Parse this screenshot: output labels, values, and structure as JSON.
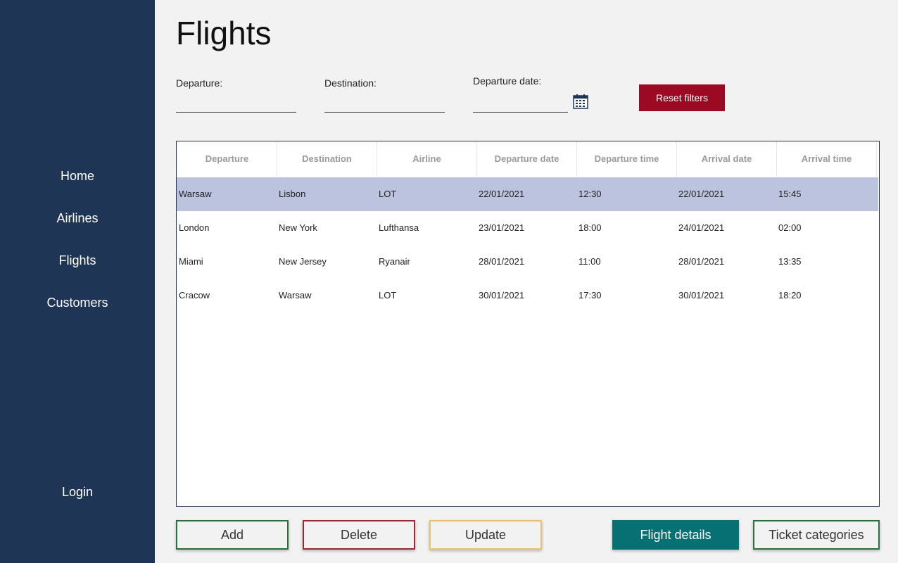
{
  "sidebar": {
    "items": [
      {
        "label": "Home"
      },
      {
        "label": "Airlines"
      },
      {
        "label": "Flights"
      },
      {
        "label": "Customers"
      }
    ],
    "login_label": "Login"
  },
  "page": {
    "title": "Flights"
  },
  "filters": {
    "departure_label": "Departure:",
    "departure_value": "",
    "destination_label": "Destination:",
    "destination_value": "",
    "date_label": "Departure date:",
    "date_value": "",
    "calendar_icon": "calendar-icon",
    "reset_label": "Reset filters"
  },
  "table": {
    "columns": [
      "Departure",
      "Destination",
      "Airline",
      "Departure date",
      "Departure time",
      "Arrival date",
      "Arrival time"
    ],
    "selected_row": 0,
    "rows": [
      [
        "Warsaw",
        "Lisbon",
        "LOT",
        "22/01/2021",
        "12:30",
        "22/01/2021",
        "15:45"
      ],
      [
        "London",
        "New York",
        "Lufthansa",
        "23/01/2021",
        "18:00",
        "24/01/2021",
        "02:00"
      ],
      [
        "Miami",
        "New Jersey",
        "Ryanair",
        "28/01/2021",
        "11:00",
        "28/01/2021",
        "13:35"
      ],
      [
        "Cracow",
        "Warsaw",
        "LOT",
        "30/01/2021",
        "17:30",
        "30/01/2021",
        "18:20"
      ]
    ]
  },
  "actions": {
    "add_label": "Add",
    "delete_label": "Delete",
    "update_label": "Update",
    "details_label": "Flight details",
    "tickets_label": "Ticket categories"
  },
  "colors": {
    "sidebar": "#1f3555",
    "reset": "#9b0a22",
    "selected_row": "#bcc3df",
    "details": "#067072"
  }
}
